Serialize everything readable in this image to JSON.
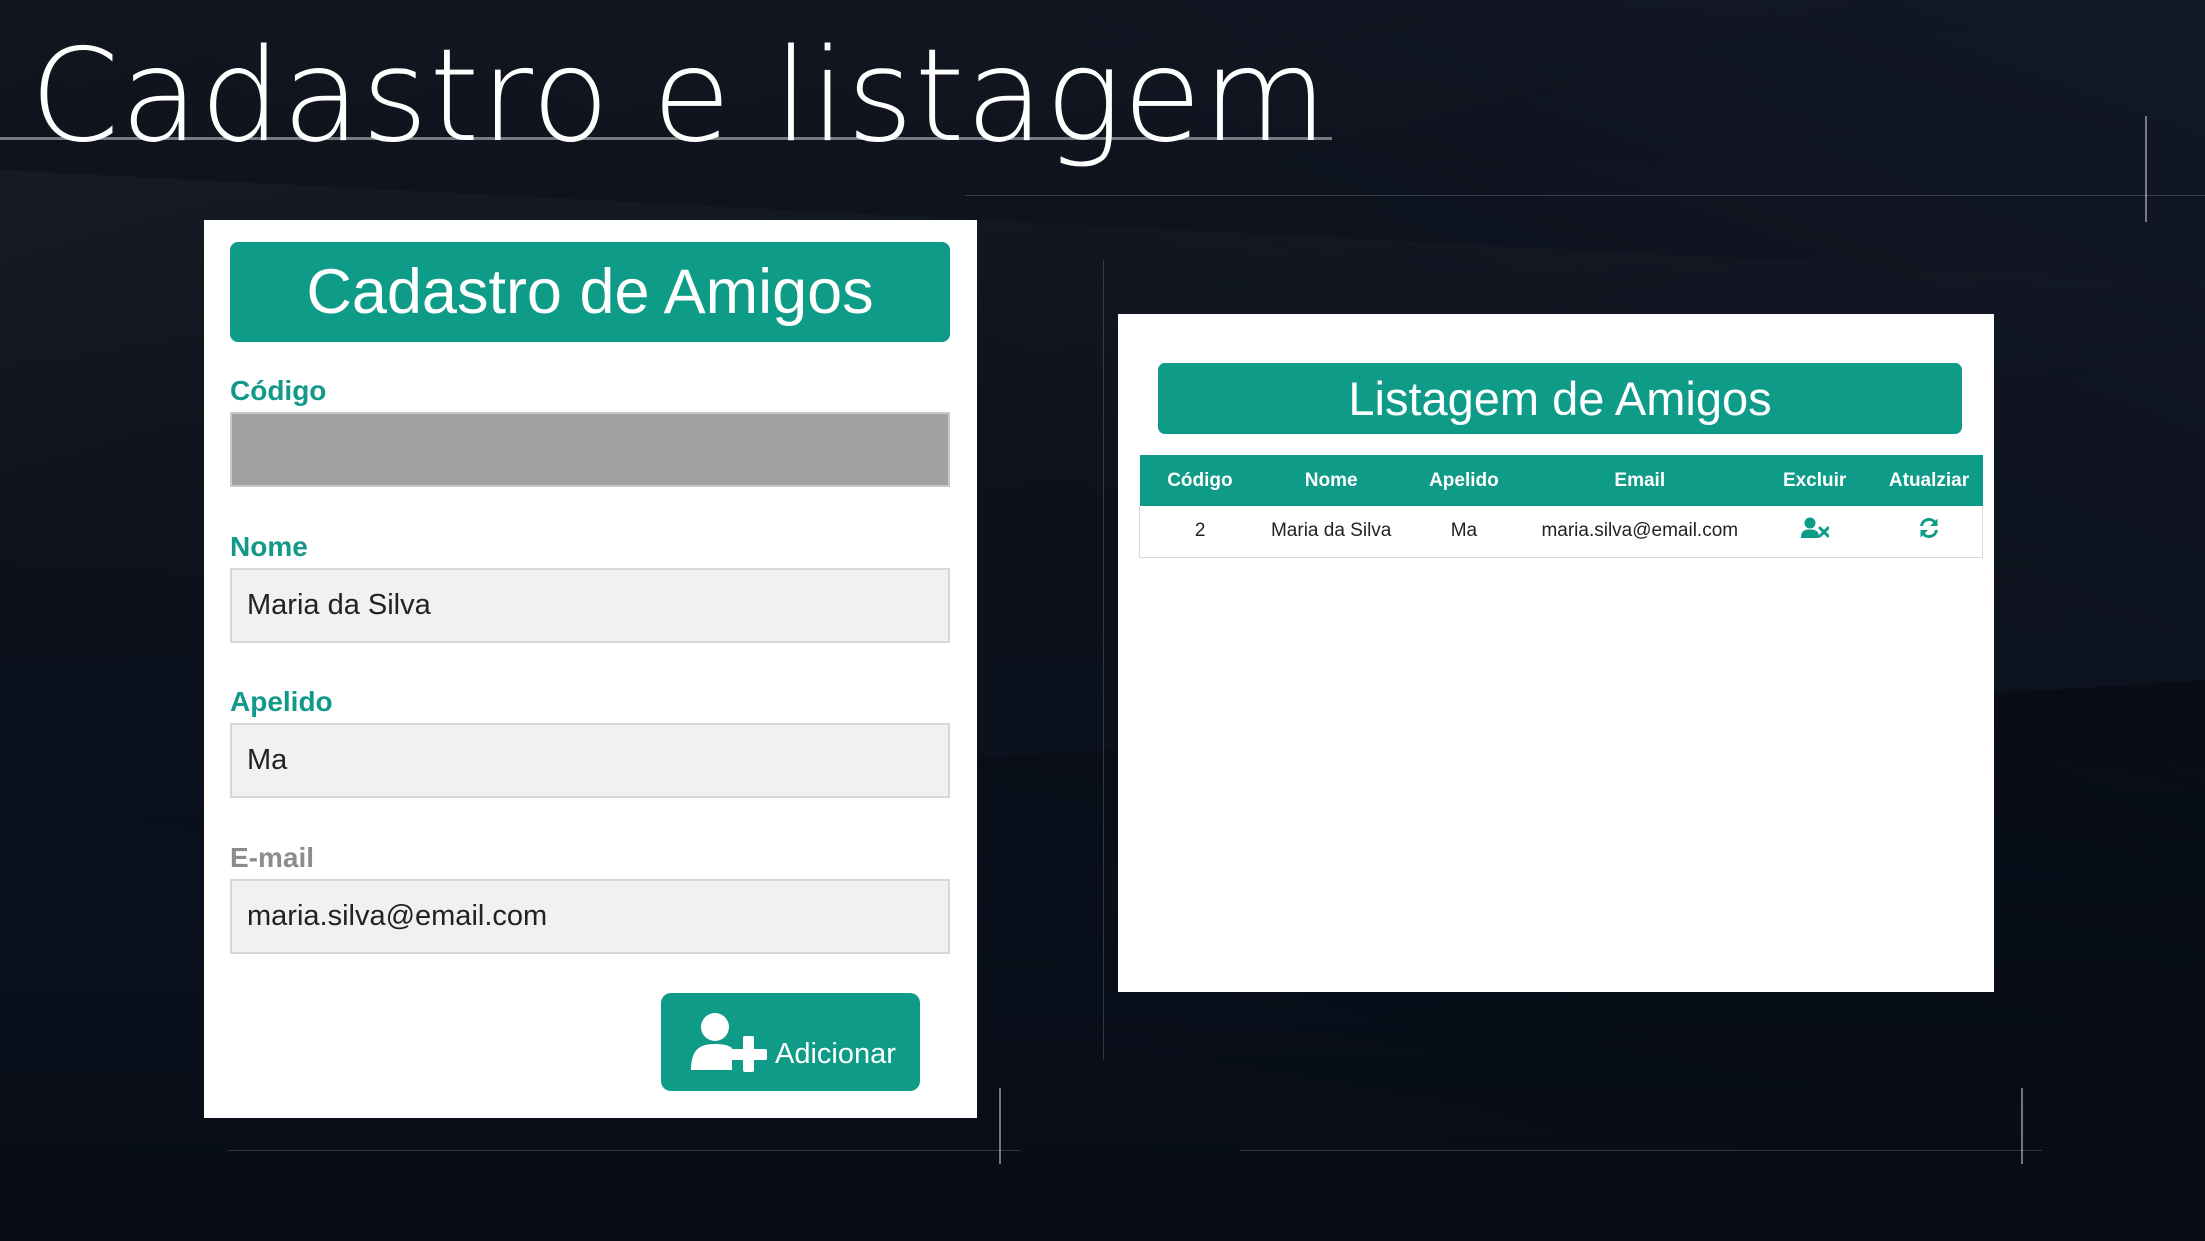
{
  "slide": {
    "title": "Cadastro e listagem"
  },
  "form": {
    "header": "Cadastro de Amigos",
    "fields": {
      "codigo": {
        "label": "Código",
        "value": ""
      },
      "nome": {
        "label": "Nome",
        "value": "Maria da Silva"
      },
      "apelido": {
        "label": "Apelido",
        "value": "Ma"
      },
      "email": {
        "label": "E-mail",
        "value": "maria.silva@email.com"
      }
    },
    "add_button": {
      "label": "Adicionar",
      "icon": "user-plus-icon"
    }
  },
  "list": {
    "header": "Listagem de Amigos",
    "columns": [
      "Código",
      "Nome",
      "Apelido",
      "Email",
      "Excluir",
      "Atualziar"
    ],
    "rows": [
      {
        "codigo": "2",
        "nome": "Maria da Silva",
        "apelido": "Ma",
        "email": "maria.silva@email.com",
        "excluir_icon": "user-times-icon",
        "atualizar_icon": "refresh-icon"
      }
    ]
  },
  "colors": {
    "accent": "#0e9c88",
    "label": "#13998a",
    "background": "#0b0f18",
    "panel": "#ffffff"
  }
}
